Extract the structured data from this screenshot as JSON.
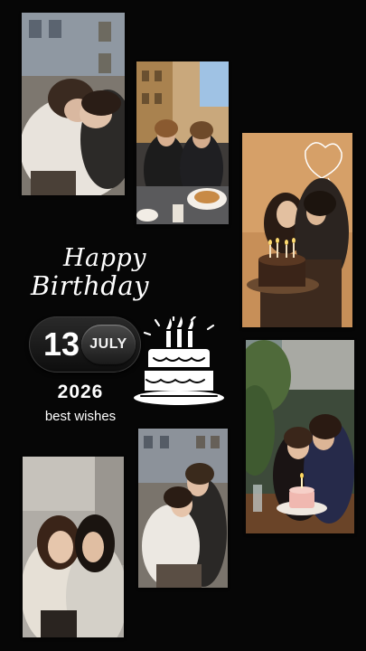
{
  "title": {
    "line1": "Happy",
    "line2": "Birthday"
  },
  "date": {
    "day": "13",
    "month": "JULY",
    "year": "2026"
  },
  "message": "best wishes",
  "colors": {
    "background": "#060606",
    "text": "#ffffff",
    "pill": "#1a1a1a"
  },
  "photos": [
    {
      "name": "photo-hug-street",
      "icon": "photo"
    },
    {
      "name": "photo-cafe-table",
      "icon": "photo"
    },
    {
      "name": "photo-cake-candles",
      "icon": "photo"
    },
    {
      "name": "photo-restaurant-cake",
      "icon": "photo"
    },
    {
      "name": "photo-selfie",
      "icon": "photo"
    },
    {
      "name": "photo-embrace-street",
      "icon": "photo"
    }
  ],
  "decoration": {
    "cake_icon": "birthday-cake-icon",
    "heart_doodle": "heart-doodle-icon"
  }
}
